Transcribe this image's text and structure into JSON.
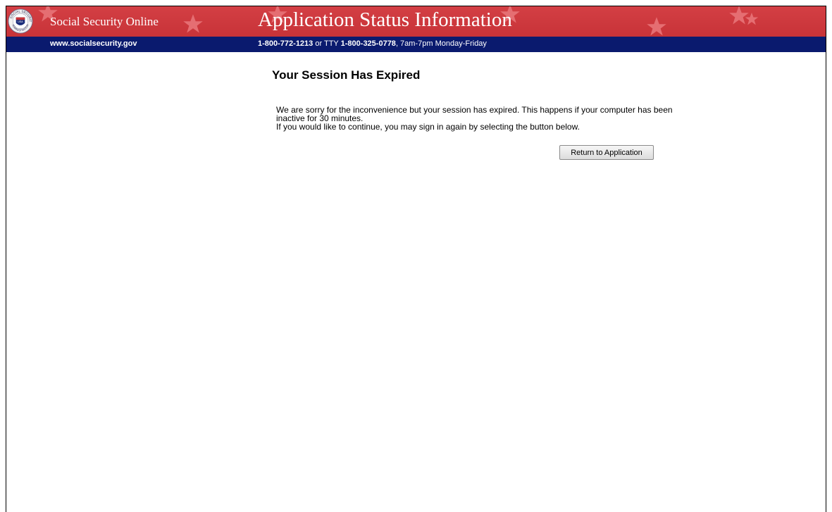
{
  "header": {
    "site_name": "Social Security Online",
    "title": "Application Status Information",
    "url": "www.socialsecurity.gov",
    "phone": "1-800-772-1213",
    "or_text": "or TTY",
    "tty_phone": "1-800-325-0778",
    "hours": ", 7am-7pm Monday-Friday",
    "logo": {
      "icon": "ssa-seal-icon",
      "text_top": "SOCIAL SECURITY",
      "text_bottom": "ADMINISTRATION",
      "shield_text": "USA"
    },
    "colors": {
      "banner": "#c83338",
      "subbar": "#0a1a6e",
      "star": "#e56e72"
    }
  },
  "main": {
    "heading": "Your Session Has Expired",
    "message_line1": "We are sorry for the inconvenience but your session has expired. This happens if your computer has been inactive for 30 minutes.",
    "message_line2": "If you would like to continue, you may sign in again by selecting the button below.",
    "return_button": "Return to Application"
  }
}
